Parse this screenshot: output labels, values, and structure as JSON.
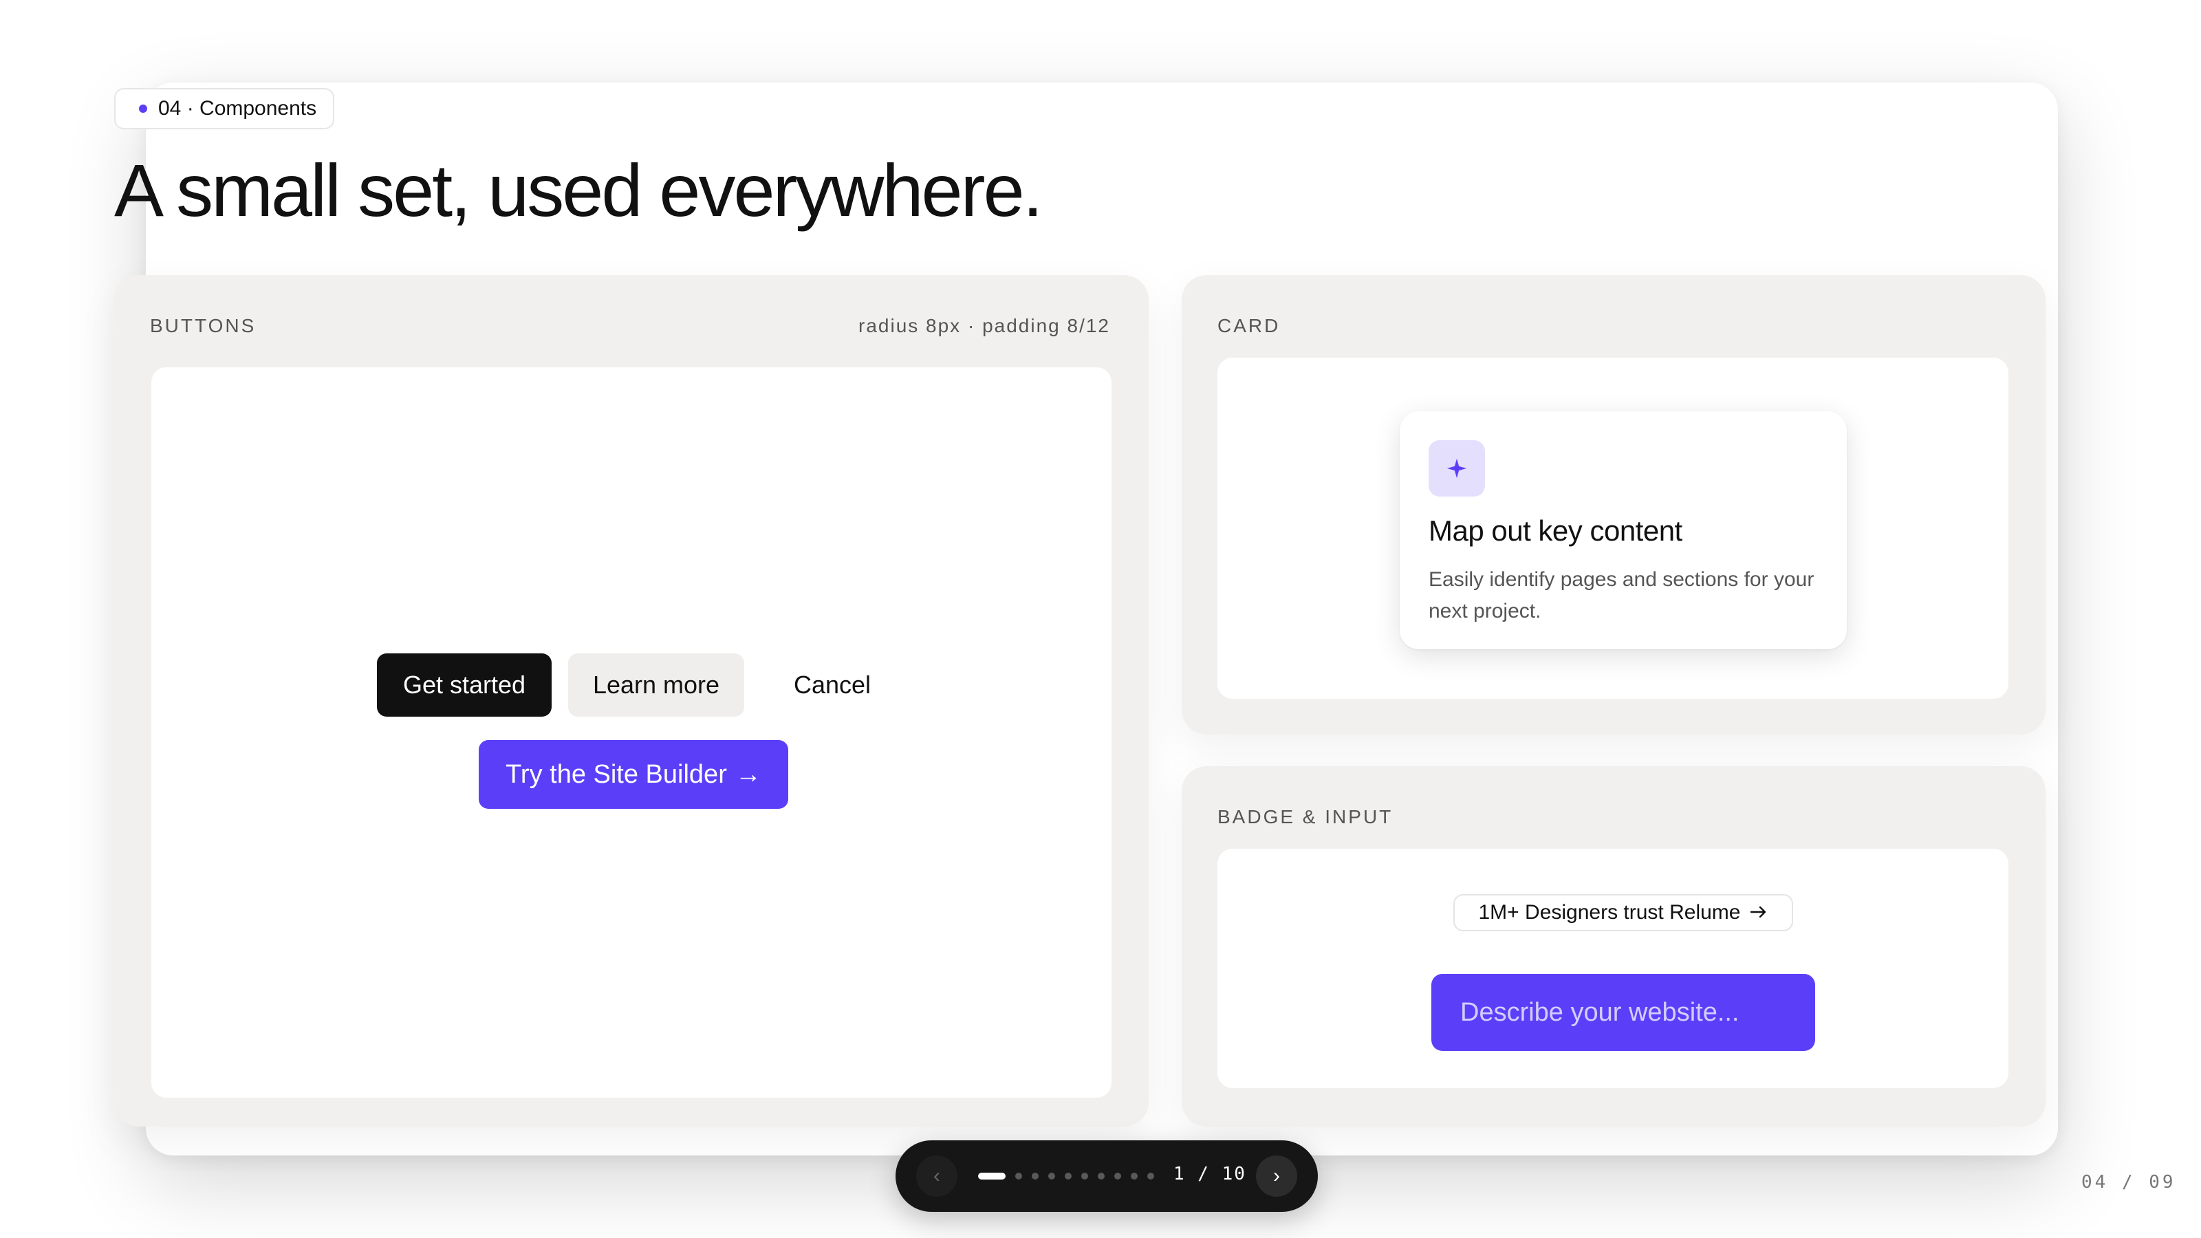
{
  "eyebrow": {
    "text": "04 · Components"
  },
  "title": "A small set, used everywhere.",
  "buttons_panel": {
    "label": "BUTTONS",
    "meta": "radius 8px · padding 8/12",
    "get_started": "Get started",
    "learn_more": "Learn more",
    "cancel": "Cancel",
    "site_builder": "Try the Site Builder",
    "site_builder_arrow": "→"
  },
  "card_panel": {
    "label": "CARD",
    "card": {
      "icon": "sparkle-icon",
      "title": "Map out key content",
      "description": "Easily identify pages and sections for your next project."
    }
  },
  "badge_input_panel": {
    "label": "BADGE & INPUT",
    "badge_text": "1M+ Designers trust Relume",
    "badge_icon": "arrow-right-icon",
    "input_placeholder": "Describe your website..."
  },
  "pager": {
    "prev": "‹",
    "next": "›",
    "count": "1 / 10",
    "current": 1,
    "total": 10
  },
  "slide_number": "04 / 09",
  "colors": {
    "accent": "#5b3ff8",
    "panel": "#f1f0ee",
    "dark": "#111111"
  }
}
